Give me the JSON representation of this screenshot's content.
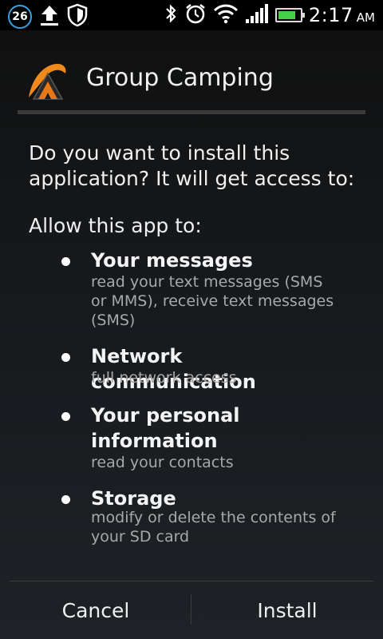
{
  "status_bar": {
    "notification_count": "26",
    "time": "2:17",
    "ampm": "AM",
    "battery_level": 0.8,
    "icons": [
      "upload-icon",
      "shield-icon",
      "bluetooth-icon",
      "alarm-icon",
      "wifi-icon",
      "signal-icon",
      "battery-icon"
    ]
  },
  "dialog": {
    "app_name": "Group Camping",
    "intro": "Do you want to install this application? It will get access to:",
    "allow_label": "Allow this app to:",
    "permissions": [
      {
        "title": "Your messages",
        "description": "read your text messages (SMS or MMS), receive text messages (SMS)"
      },
      {
        "title": "Network communication",
        "description": "full network access"
      },
      {
        "title": "Your personal information",
        "description": "read your contacts"
      },
      {
        "title": "Storage",
        "description": "modify or delete the contents of your SD card"
      }
    ],
    "cancel_label": "Cancel",
    "install_label": "Install"
  },
  "colors": {
    "accent_orange": "#f08a1c",
    "battery_green": "#44d044",
    "notification_ring": "#3aa0e0"
  }
}
